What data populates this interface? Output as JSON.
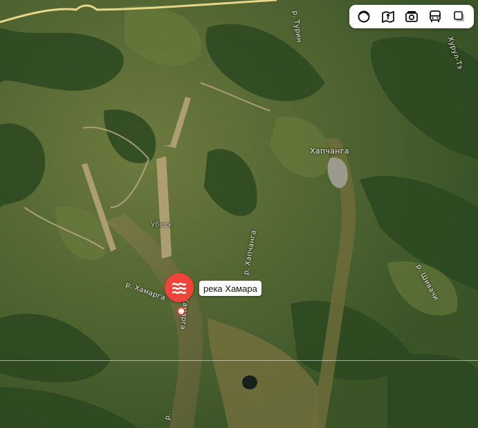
{
  "toolbar": {
    "buttons": [
      {
        "name": "layers-icon"
      },
      {
        "name": "panorama-icon"
      },
      {
        "name": "photo-icon"
      },
      {
        "name": "transport-icon"
      },
      {
        "name": "map-type-icon"
      }
    ]
  },
  "labels": {
    "river_turin": "р. Турин",
    "river_khurul": "Хурул-Тэ",
    "settlement": "Хапчанга",
    "river_khapchanga": "р. Хапчанга",
    "settlement_old": "Убеск",
    "river_shivachi": "р. Шивачи",
    "river_khamara": "р. Хамарга",
    "river_khamara_2": "Хамарга",
    "river_bottom": "р."
  },
  "place": {
    "name": "река Хамара",
    "pin_icon": "water-waves-icon",
    "accent": "#f0443a"
  }
}
